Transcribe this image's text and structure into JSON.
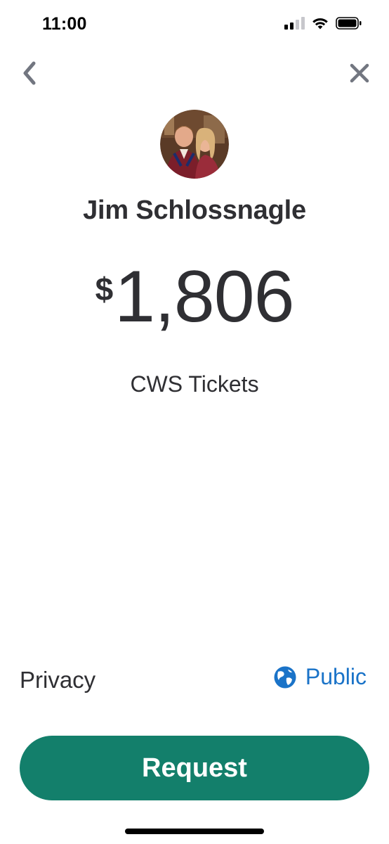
{
  "status_bar": {
    "time": "11:00",
    "signal_icon": "cellular-signal-icon",
    "wifi_icon": "wifi-icon",
    "battery_icon": "battery-icon"
  },
  "nav": {
    "back_icon": "chevron-left-icon",
    "close_icon": "close-icon"
  },
  "recipient": {
    "name": "Jim Schlossnagle",
    "avatar_icon": "profile-photo"
  },
  "payment": {
    "currency_symbol": "$",
    "amount": "1,806",
    "note": "CWS Tickets"
  },
  "privacy": {
    "label": "Privacy",
    "value": "Public",
    "icon": "globe-icon",
    "accent_color": "#1a73c8"
  },
  "actions": {
    "request_label": "Request",
    "button_color": "#137f6b"
  }
}
